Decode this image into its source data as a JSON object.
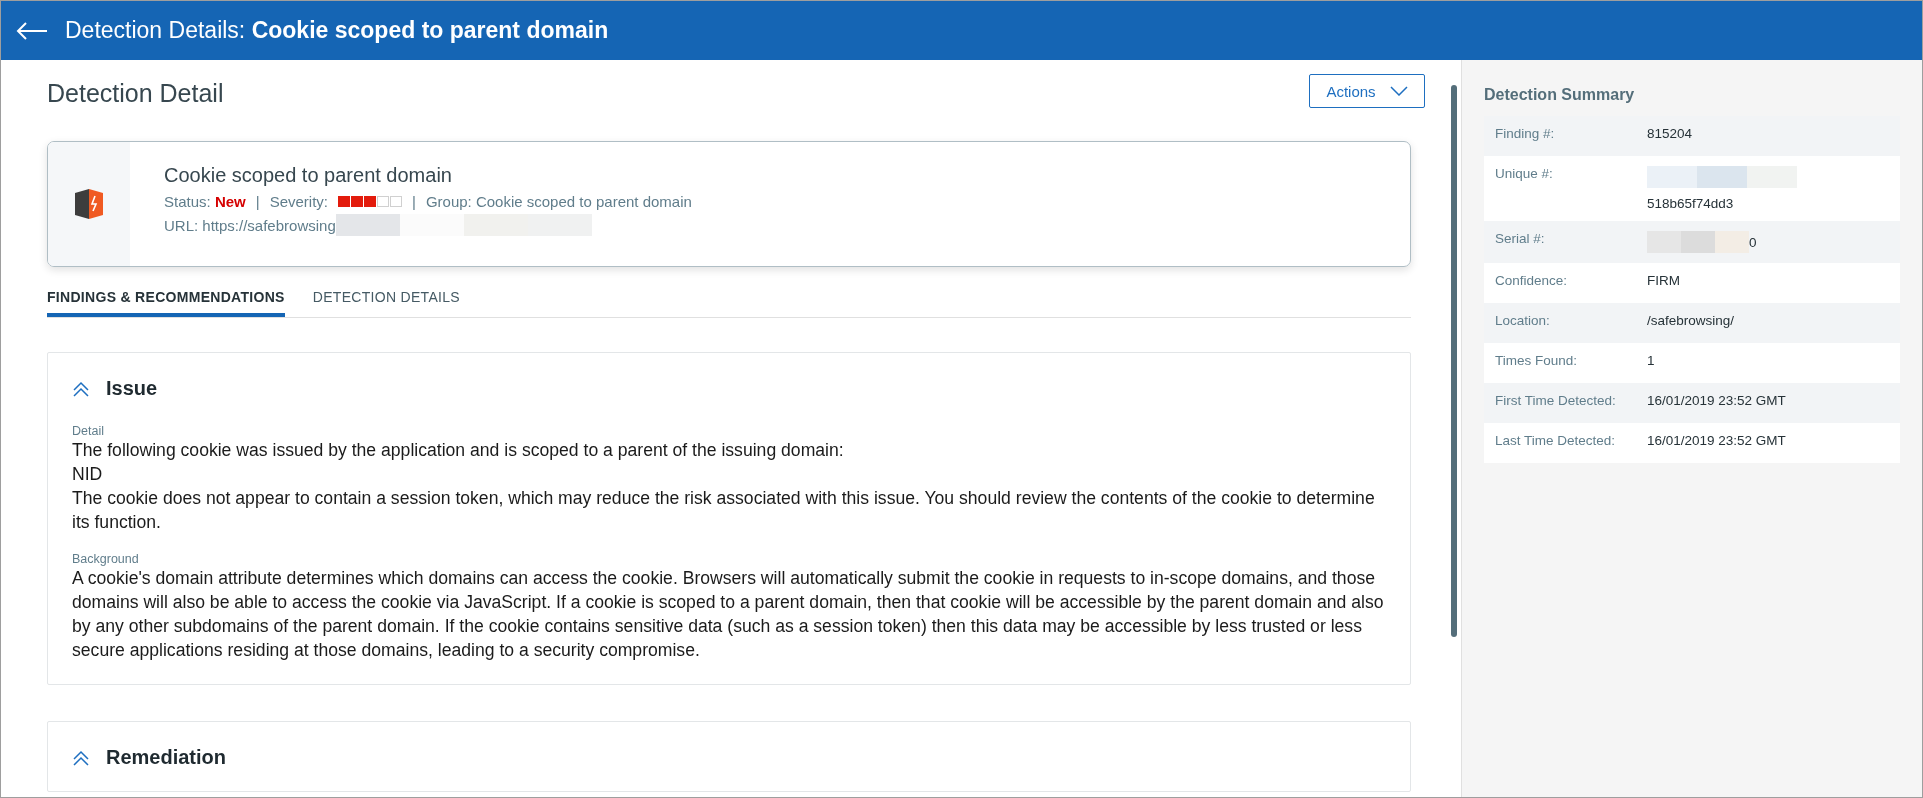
{
  "header": {
    "prefix": "Detection Details:",
    "title": "Cookie scoped to parent domain"
  },
  "page_title": "Detection Detail",
  "actions_button": {
    "label": "Actions"
  },
  "detection_card": {
    "name": "Cookie scoped to parent domain",
    "status_label": "Status:",
    "status": "New",
    "separators": [
      "|",
      "|"
    ],
    "severity_label": "Severity:",
    "severity": {
      "stars": 3
    },
    "group": "Group: Cookie scoped to parent domain",
    "url": "URL: https://safebrowsing"
  },
  "tabs": [
    {
      "label": "FINDINGS & RECOMMENDATIONS",
      "selected": true
    },
    {
      "label": "DETECTION DETAILS",
      "selected": false
    }
  ],
  "sections": [
    {
      "title": "Issue",
      "expanded": true,
      "blocks": [
        {
          "label": "Detail",
          "paragraphs": [
            "The following cookie was issued by the application and is scoped to a parent of the issuing domain:",
            "NID",
            "The cookie does not appear to contain a session token, which may reduce the risk associated with this issue. You should review the contents of the cookie to determine its function."
          ]
        },
        {
          "label": "Background",
          "paragraphs": [
            "A cookie's domain attribute determines which domains can access the cookie. Browsers will automatically submit the cookie in requests to in-scope domains, and those domains will also be able to access the cookie via JavaScript. If a cookie is scoped to a parent domain, then that cookie will be accessible by the parent domain and also by any other subdomains of the parent domain. If the cookie contains sensitive data (such as a session token) then this data may be accessible by less trusted or less secure applications residing at those domains, leading to a security compromise."
          ]
        }
      ]
    },
    {
      "title": "Remediation",
      "expanded": true
    }
  ],
  "summary": {
    "title": "Detection Summary",
    "rows": [
      {
        "label": "Finding #:",
        "value": "815204",
        "kind": "plain"
      },
      {
        "label": "Unique #:",
        "value": "518b65f74dd3",
        "kind": "redacted-above"
      },
      {
        "label": "Serial #:",
        "value": "0",
        "kind": "redacted-before"
      },
      {
        "label": "Confidence:",
        "value": "FIRM",
        "kind": "plain"
      },
      {
        "label": "Location:",
        "value": "/safebrowsing/",
        "kind": "plain"
      },
      {
        "label": "Times Found:",
        "value": "1",
        "kind": "plain"
      },
      {
        "label": "First Time Detected:",
        "value": "16/01/2019 23:52 GMT",
        "kind": "plain"
      },
      {
        "label": "Last Time Detected:",
        "value": "16/01/2019 23:52 GMT",
        "kind": "plain"
      }
    ]
  }
}
